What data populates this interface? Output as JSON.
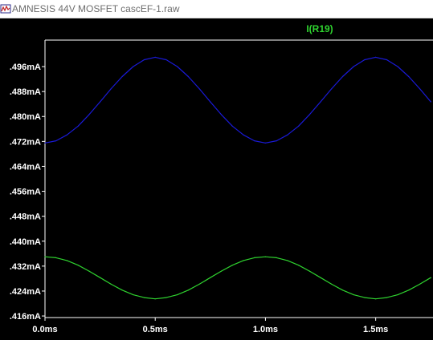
{
  "window": {
    "title": "AMNESIS 44V MOSFET cascEF-1.raw",
    "icon": "waveform-viewer-icon"
  },
  "colors": {
    "background": "#000000",
    "axis": "#ffffff",
    "label": "#ffffff",
    "series_top": "#1a1ad8",
    "series_bottom": "#2fd32f",
    "trace_label": "#2fd32f"
  },
  "chart_data": {
    "type": "line",
    "trace_label": "I(R19)",
    "xlabel": "",
    "ylabel": "",
    "x_ticks": [
      {
        "value": 0.0,
        "label": "0.0ms"
      },
      {
        "value": 0.5,
        "label": "0.5ms"
      },
      {
        "value": 1.0,
        "label": "1.0ms"
      },
      {
        "value": 1.5,
        "label": "1.5ms"
      }
    ],
    "y_ticks": [
      {
        "value": 0.496,
        "label": ".496mA"
      },
      {
        "value": 0.488,
        "label": ".488mA"
      },
      {
        "value": 0.48,
        "label": ".480mA"
      },
      {
        "value": 0.472,
        "label": ".472mA"
      },
      {
        "value": 0.464,
        "label": ".464mA"
      },
      {
        "value": 0.456,
        "label": ".456mA"
      },
      {
        "value": 0.448,
        "label": ".448mA"
      },
      {
        "value": 0.44,
        "label": ".440mA"
      },
      {
        "value": 0.432,
        "label": ".432mA"
      },
      {
        "value": 0.424,
        "label": ".424mA"
      },
      {
        "value": 0.416,
        "label": ".416mA"
      }
    ],
    "xlim": [
      0.0,
      1.76
    ],
    "ylim": [
      0.4155,
      0.5045
    ],
    "grid": false,
    "series": [
      {
        "color": "#1a1ad8",
        "x": [
          0.0,
          0.05,
          0.1,
          0.15,
          0.2,
          0.25,
          0.3,
          0.35,
          0.4,
          0.45,
          0.5,
          0.55,
          0.6,
          0.65,
          0.7,
          0.75,
          0.8,
          0.85,
          0.9,
          0.95,
          1.0,
          1.05,
          1.1,
          1.15,
          1.2,
          1.25,
          1.3,
          1.35,
          1.4,
          1.45,
          1.5,
          1.55,
          1.6,
          1.65,
          1.7,
          1.75
        ],
        "values": [
          0.4715,
          0.4722,
          0.4741,
          0.4769,
          0.4806,
          0.4847,
          0.4889,
          0.4928,
          0.496,
          0.4982,
          0.499,
          0.4982,
          0.496,
          0.4928,
          0.4889,
          0.4847,
          0.4806,
          0.4769,
          0.4741,
          0.4722,
          0.4715,
          0.4722,
          0.4741,
          0.4769,
          0.4806,
          0.4847,
          0.4889,
          0.4928,
          0.496,
          0.4982,
          0.499,
          0.4982,
          0.496,
          0.4928,
          0.4889,
          0.4847
        ]
      },
      {
        "color": "#2fd32f",
        "x": [
          0.0,
          0.05,
          0.1,
          0.15,
          0.2,
          0.25,
          0.3,
          0.35,
          0.4,
          0.45,
          0.5,
          0.55,
          0.6,
          0.65,
          0.7,
          0.75,
          0.8,
          0.85,
          0.9,
          0.95,
          1.0,
          1.05,
          1.1,
          1.15,
          1.2,
          1.25,
          1.3,
          1.35,
          1.4,
          1.45,
          1.5,
          1.55,
          1.6,
          1.65,
          1.7,
          1.75
        ],
        "values": [
          0.435,
          0.4347,
          0.4338,
          0.4323,
          0.4304,
          0.4283,
          0.4262,
          0.4243,
          0.4228,
          0.4219,
          0.4215,
          0.4219,
          0.4228,
          0.4243,
          0.4262,
          0.4283,
          0.4304,
          0.4323,
          0.4338,
          0.4347,
          0.435,
          0.4347,
          0.4338,
          0.4323,
          0.4304,
          0.4283,
          0.4262,
          0.4243,
          0.4228,
          0.4219,
          0.4215,
          0.4219,
          0.4228,
          0.4243,
          0.4262,
          0.4283
        ]
      }
    ]
  }
}
